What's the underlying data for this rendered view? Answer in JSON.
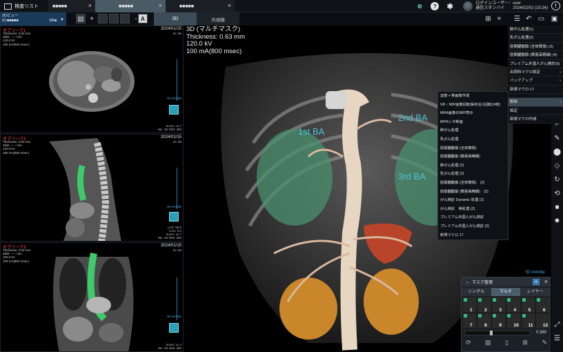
{
  "topbar": {
    "tabs": [
      {
        "label": "検査リスト"
      },
      {
        "label": "■■■■■",
        "close": "×"
      },
      {
        "label": "■■■■■",
        "close": "×"
      },
      {
        "label": "■■■■■",
        "close": "×"
      }
    ],
    "user_line1": "ログインユーザー：user",
    "user_line2": "通信スタンバイ　　2024/02/02 (15:34)"
  },
  "toolbar2": {
    "view_title": "3Dビュー",
    "view_sub": "ID:■■■■■",
    "view_count": "MB■",
    "tab_3d": "3D",
    "tab_endo": "内視鏡"
  },
  "viewports": [
    {
      "title": "オブリーク1",
      "meta": [
        "Thickness: 0.63 mm",
        "Slab: ----- mm",
        "120.0 kV",
        "100 mA(800 msec)"
      ],
      "date": "2024/01/15",
      "img": "Im: 86",
      "scale": "50 mm/div",
      "zoom": [
        "Zoom: x1.7",
        "WL: 50 WW: 350"
      ]
    },
    {
      "title": "オブリーク2",
      "meta": [
        "Thickness: 0.63 mm",
        "Slab: ----- mm",
        "120.0 kV",
        "100 mA(800 msec)"
      ],
      "date": "2024/01/15",
      "img": "Im: 86",
      "scale": "50 mm/div",
      "zoom": [
        "LAO: 90.0",
        "CAU: 0.0",
        "Zoom: x1.7",
        "WL: 50 WW: 350"
      ]
    },
    {
      "title": "オブリーク3",
      "meta": [
        "Thickness: 0.63 mm",
        "Slab: ----- mm",
        "120.0 kV",
        "100 mA(800 msec)"
      ],
      "date": "2024/01/15",
      "img": "Im: 86",
      "scale": "50 mm/div",
      "zoom": [
        "Zoom: x1.7",
        "WL: 50 WW: 350"
      ]
    }
  ],
  "main3d": {
    "title": "3D (マルチマスク)",
    "lines": [
      "Thickness: 0.63 mm",
      "120.0 kV",
      "100 mA(800 msec)"
    ],
    "labels": {
      "ba1": "1st BA",
      "ba2": "2nd BA",
      "ba3": "3rd BA"
    },
    "scale": "50 mm/div"
  },
  "right_menu": [
    {
      "label": "肺がん処理(1)",
      "arrow": ""
    },
    {
      "label": "乳がん処理(2)",
      "arrow": ""
    },
    {
      "label": "肋間腱動脈 (全体簡易) (3)",
      "arrow": ""
    },
    {
      "label": "肋間腱動脈 (簡易高精細) (4)",
      "arrow": ""
    },
    {
      "label": "プレミアム外国人がん検診(5)",
      "arrow": ""
    },
    {
      "label": "出荷時マクロ設定",
      "arrow": "›"
    },
    {
      "label": "バックアップ",
      "arrow": "›"
    },
    {
      "label": "新規マクロ 17",
      "arrow": ""
    },
    {
      "label": "",
      "arrow": ""
    },
    {
      "label": "削除",
      "arrow": "›"
    },
    {
      "label": "設定",
      "arrow": ""
    },
    {
      "label": "新規マクロ作成",
      "arrow": ""
    }
  ],
  "submenu": [
    "血管＋骨画像作成",
    "VR・MIP画像回転保存(右1回転24枚)",
    "MRA画像のMIP表示",
    "MPRシネ断面",
    "肺がん処理",
    "乳がん処理",
    "肋間腱動脈 (全体簡易)",
    "肋間腱動脈 (簡易高精細)",
    "肺がん処理 (2)",
    "乳がん処理 (2)",
    "肋間腱動脈 (全体簡易)　(2)",
    "肋間腱動脈 (簡易高精細)　(2)",
    "がん検診 Dynamic 処理 (2)",
    "がん検診　骨処理 (2)",
    "プレミアム外国人がん検診",
    "プレミアム外国人がん検診 (2)",
    "新規マクロ 17"
  ],
  "mask_panel": {
    "title": "マスク管理",
    "tabs": [
      "シングル",
      "マルチ",
      "レイヤー"
    ],
    "cells": [
      "1",
      "2",
      "3",
      "4",
      "5",
      "6",
      "7",
      "8",
      "9",
      "10",
      "11",
      "12"
    ],
    "value": "0.380"
  },
  "colors": {
    "accent": "#4cc3d6",
    "tab_active": "#4b5b66",
    "menu_selected": "#3c4853",
    "check_green": "#2bbf7a",
    "series_red": "#ff4f4f"
  }
}
